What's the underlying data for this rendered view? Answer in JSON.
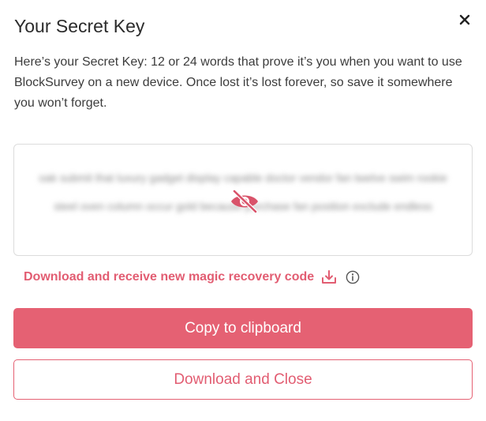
{
  "dialog": {
    "title": "Your Secret Key",
    "description": "Here’s your Secret Key: 12 or 24 words that prove it’s you when you want to use BlockSurvey on a new device. Once lost it’s lost forever, so save it somewhere you won’t forget.",
    "close_icon": "close-icon"
  },
  "secret_key": {
    "words": "oak submit that luxury gadget display capable doctor vendor fan twelve swim rookie steel oven column occur gold because purchase fan position exclude endless",
    "hidden_icon": "eye-slash-icon"
  },
  "magic_recovery": {
    "label": "Download and receive new magic recovery code",
    "download_icon": "download-icon",
    "info_icon": "info-icon"
  },
  "buttons": {
    "copy_label": "Copy to clipboard",
    "download_close_label": "Download and Close"
  },
  "colors": {
    "accent": "#e56173",
    "accent_text": "#e25d72",
    "border": "#dcdcdc"
  }
}
